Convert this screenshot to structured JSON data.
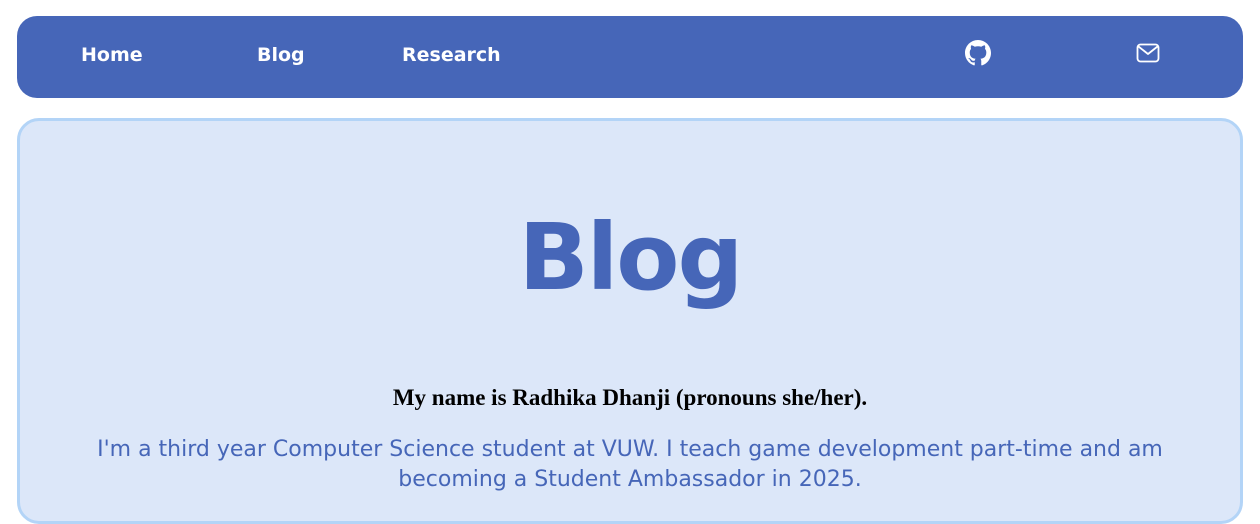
{
  "nav": {
    "home_label": "Home",
    "blog_label": "Blog",
    "research_label": "Research",
    "icons": [
      "github-icon",
      "mail-icon"
    ]
  },
  "main": {
    "title": "Blog",
    "heading": "My name is Radhika Dhanji (pronouns she/her).",
    "intro": "I'm a third year Computer Science student at VUW. I teach game development part-time and am becoming a Student Ambassador in 2025."
  },
  "colors": {
    "brand": "#4666b8",
    "card_background": "#dce7f9",
    "card_border": "#b3d4f7"
  }
}
